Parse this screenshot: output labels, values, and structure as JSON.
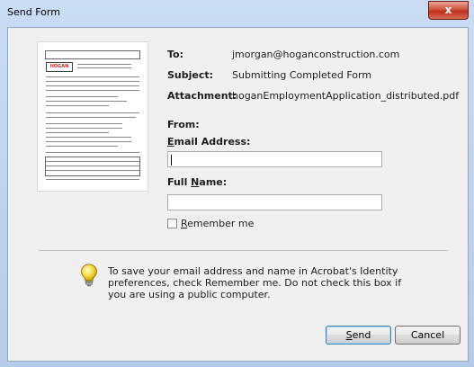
{
  "window": {
    "title": "Send Form",
    "close_label": "x"
  },
  "details": {
    "to_label": "To:",
    "to_value": "jmorgan@hoganconstruction.com",
    "subject_label": "Subject:",
    "subject_value": "Submitting Completed Form",
    "attachment_label": "Attachment:",
    "attachment_value": "hoganEmploymentApplication_distributed.pdf"
  },
  "from": {
    "heading": "From:",
    "email_label_pre": "",
    "email_label_mnemonic": "E",
    "email_label_post": "mail Address:",
    "email_value": "",
    "name_label_pre": "Full ",
    "name_label_mnemonic": "N",
    "name_label_post": "ame:",
    "name_value": ""
  },
  "remember": {
    "mnemonic": "R",
    "rest": "emember me",
    "checked": false
  },
  "info_text": "To save your email address and name in Acrobat's Identity preferences, check Remember me. Do not check this box if you are using a public computer.",
  "buttons": {
    "send_mnemonic": "S",
    "send_rest": "end",
    "cancel": "Cancel"
  },
  "preview": {
    "logo_text": "HOGAN"
  },
  "colors": {
    "accent": "#3c7fb1",
    "close": "#c0301a"
  },
  "icons": {
    "info": "lightbulb-icon",
    "close": "close-icon"
  }
}
